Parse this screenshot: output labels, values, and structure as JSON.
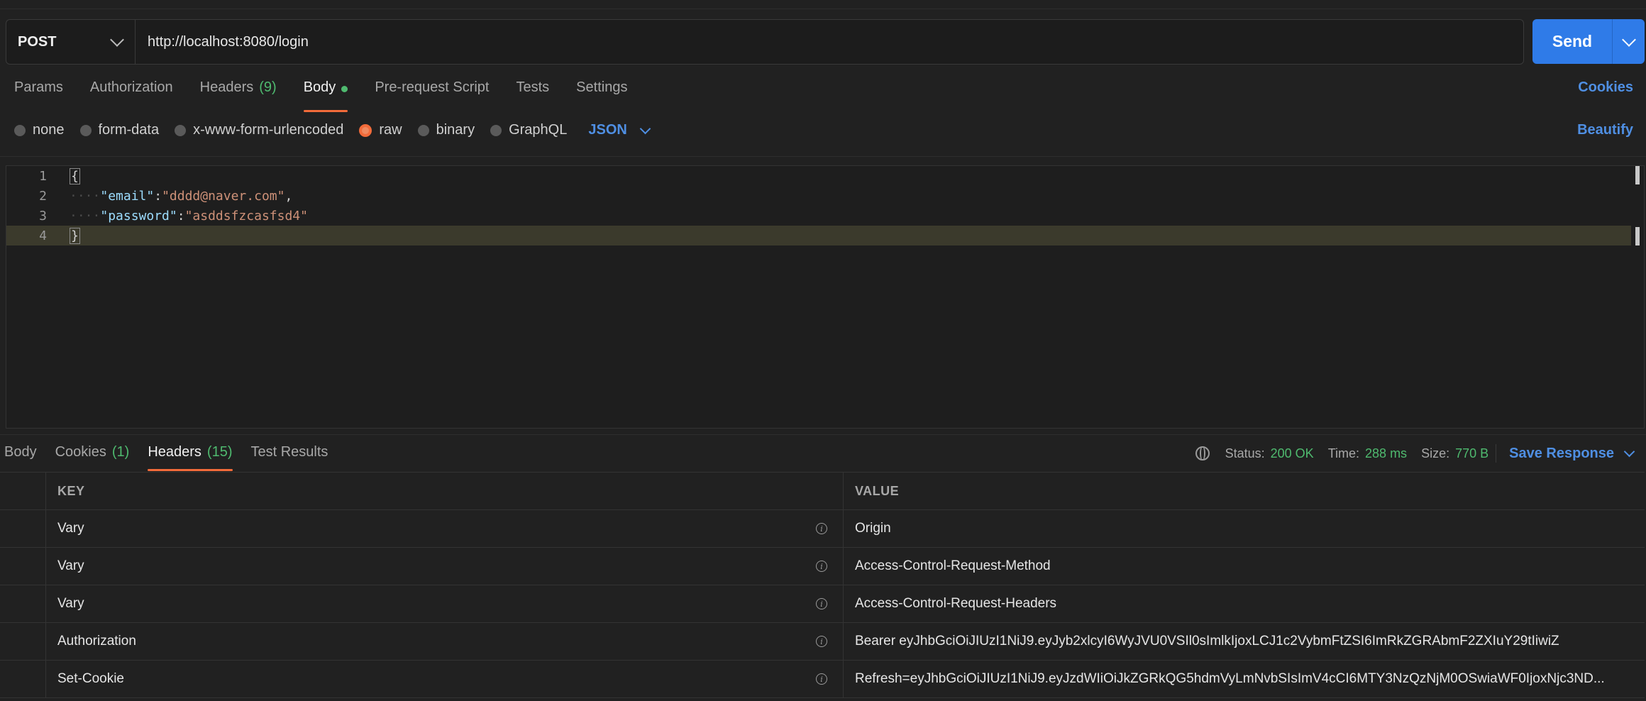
{
  "request": {
    "method": "POST",
    "url": "http://localhost:8080/login",
    "send_label": "Send"
  },
  "request_tabs": [
    {
      "label": "Params",
      "count": ""
    },
    {
      "label": "Authorization",
      "count": ""
    },
    {
      "label": "Headers",
      "count": "(9)"
    },
    {
      "label": "Body",
      "count": ""
    },
    {
      "label": "Pre-request Script",
      "count": ""
    },
    {
      "label": "Tests",
      "count": ""
    },
    {
      "label": "Settings",
      "count": ""
    }
  ],
  "cookies_label": "Cookies",
  "body_options": {
    "none": "none",
    "form_data": "form-data",
    "urlencoded": "x-www-form-urlencoded",
    "raw": "raw",
    "binary": "binary",
    "graphql": "GraphQL",
    "format": "JSON",
    "beautify": "Beautify"
  },
  "editor": {
    "line_numbers": [
      "1",
      "2",
      "3",
      "4"
    ],
    "open_brace": "{",
    "close_brace": "}",
    "email_key": "\"email\"",
    "email_value": "\"dddd@naver.com\"",
    "password_key": "\"password\"",
    "password_value": "\"asddsfzcasfsd4\"",
    "colon": ":",
    "comma": ","
  },
  "response_tabs": [
    {
      "label": "Body",
      "count": ""
    },
    {
      "label": "Cookies",
      "count": "(1)"
    },
    {
      "label": "Headers",
      "count": "(15)"
    },
    {
      "label": "Test Results",
      "count": ""
    }
  ],
  "status": {
    "status_label": "Status:",
    "status_value": "200 OK",
    "time_label": "Time:",
    "time_value": "288 ms",
    "size_label": "Size:",
    "size_value": "770 B",
    "save_response": "Save Response"
  },
  "headers_table": {
    "key_header": "KEY",
    "value_header": "VALUE",
    "rows": [
      {
        "key": "Vary",
        "value": "Origin"
      },
      {
        "key": "Vary",
        "value": "Access-Control-Request-Method"
      },
      {
        "key": "Vary",
        "value": "Access-Control-Request-Headers"
      },
      {
        "key": "Authorization",
        "value": "Bearer eyJhbGciOiJIUzI1NiJ9.eyJyb2xlcyI6WyJVU0VSIl0sImlkIjoxLCJ1c2VybmFtZSI6ImRkZGRAbmF2ZXIuY29tIiwiZ"
      },
      {
        "key": "Set-Cookie",
        "value": "Refresh=eyJhbGciOiJIUzI1NiJ9.eyJzdWIiOiJkZGRkQG5hdmVyLmNvbSIsImV4cCI6MTY3NzQzNjM0OSwiaWF0IjoxNjc3ND..."
      }
    ]
  },
  "colors": {
    "accent": "#2f7be8",
    "active_tab_underline": "#f26b3a",
    "success": "#4fba6f",
    "link": "#4f8fe3"
  }
}
